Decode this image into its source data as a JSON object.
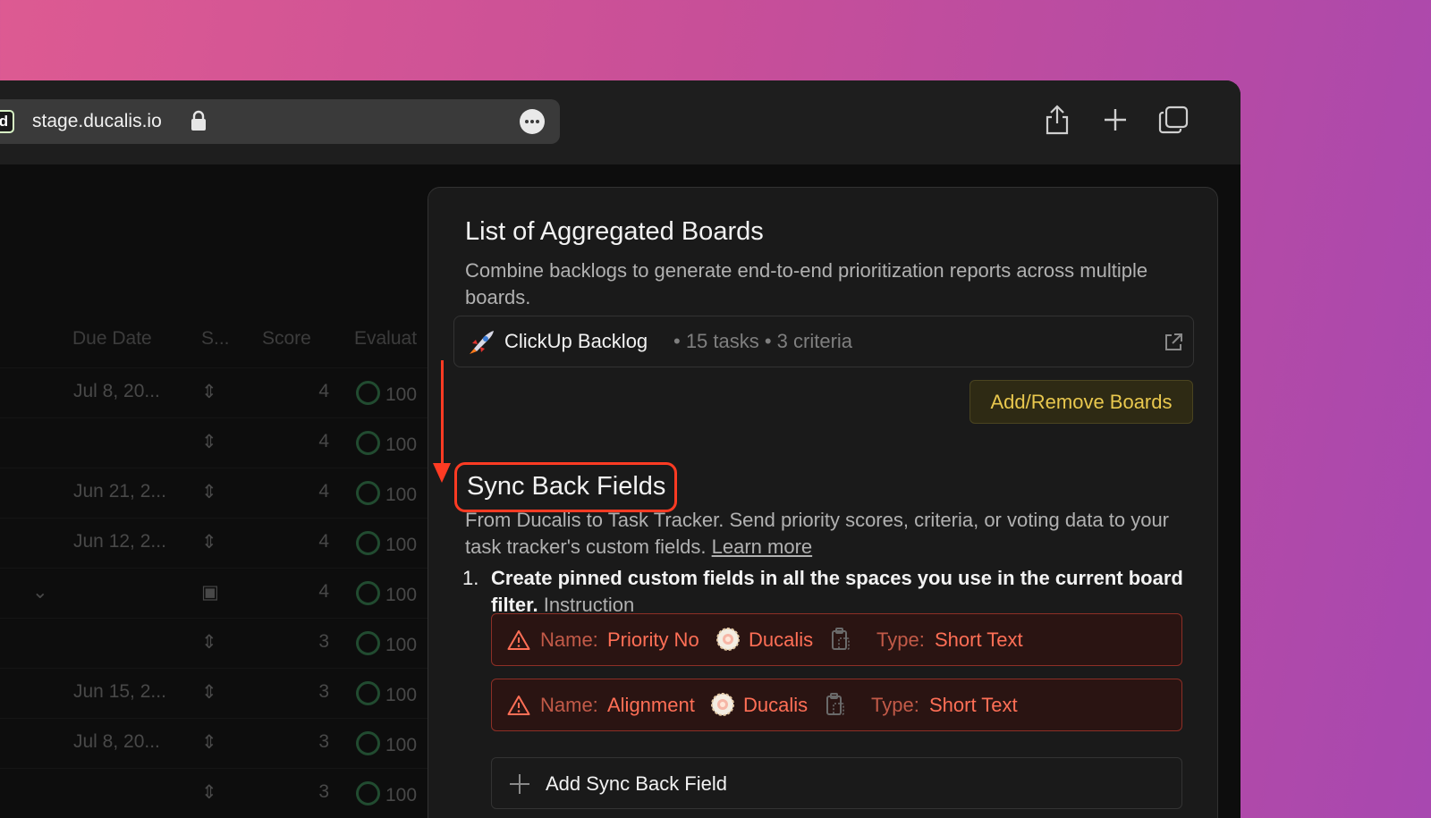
{
  "browser": {
    "favicon_letter": "d",
    "url": "stage.ducalis.io"
  },
  "table": {
    "headers": [
      "Due Date",
      "S...",
      "Score",
      "Evaluat"
    ],
    "rows": [
      {
        "date": "Jul 8, 20...",
        "score": "4",
        "eval": "100"
      },
      {
        "date": "",
        "score": "4",
        "eval": "100"
      },
      {
        "date": "Jun 21, 2...",
        "score": "4",
        "eval": "100"
      },
      {
        "date": "Jun 12, 2...",
        "score": "4",
        "eval": "100"
      },
      {
        "date": "",
        "score": "4",
        "eval": "100"
      },
      {
        "date": "",
        "score": "3",
        "eval": "100"
      },
      {
        "date": "Jun 15, 2...",
        "score": "3",
        "eval": "100"
      },
      {
        "date": "Jul 8, 20...",
        "score": "3",
        "eval": "100"
      },
      {
        "date": "",
        "score": "3",
        "eval": "100"
      }
    ]
  },
  "panel": {
    "title": "List of Aggregated Boards",
    "description": "Combine backlogs to generate end-to-end prioritization reports across multiple boards.",
    "board": {
      "name": "ClickUp Backlog",
      "meta": "• 15 tasks • 3 criteria"
    },
    "add_remove_label": "Add/Remove Boards",
    "sync": {
      "title": "Sync Back Fields",
      "description": "From Ducalis to Task Tracker. Send priority scores, criteria, or voting data to your task tracker's custom fields.",
      "learn_more": "Learn more",
      "step_number": "1.",
      "step_text": "Create pinned custom fields in all the spaces you use in the current board filter.",
      "instruction_link": "Instruction",
      "fields": [
        {
          "name_label": "Name:",
          "name": "Priority No",
          "source": "Ducalis",
          "type_label": "Type:",
          "type": "Short Text"
        },
        {
          "name_label": "Name:",
          "name": "Alignment",
          "source": "Ducalis",
          "type_label": "Type:",
          "type": "Short Text"
        }
      ],
      "add_field_label": "Add Sync Back Field"
    }
  },
  "colors": {
    "accent_red": "#ff3b23",
    "warning_text": "#ff6f56",
    "button_yellow": "#e9c84e"
  }
}
